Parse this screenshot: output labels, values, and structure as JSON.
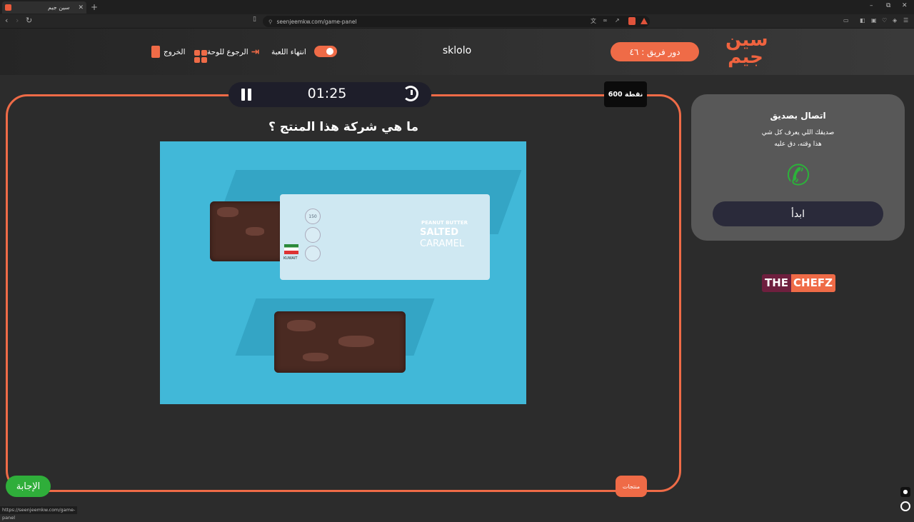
{
  "browser": {
    "tab_title": "سين جيم",
    "tab_close": "✕",
    "new_tab": "+",
    "url": "seenjeemkw.com/game-panel",
    "status_url": "https://seenjeemkw.com/game-panel",
    "window_controls": [
      "–",
      "⧉",
      "✕"
    ]
  },
  "header": {
    "logo_text_top": "سين",
    "logo_text_bottom": "جيم",
    "turn_label": "دور فريق : ٤٦",
    "team_name": "sklolo",
    "end_game_label": "انتهاء اللعبة",
    "back_to_board_label": "الرجوع للوحة",
    "exit_label": "الخروج",
    "accent_color": "#ef6b47"
  },
  "game": {
    "timer": "01:25",
    "points": "600 نقطة",
    "question": "ما هي شركة هذا المنتج ؟",
    "answer_button": "الإجابة",
    "category": "منتجات",
    "product_label": {
      "line1": "PEANUT BUTTER",
      "line2": "SALTED",
      "line3": "CARAMEL",
      "calories": "150",
      "origin": "KUWAIT"
    }
  },
  "lifeline": {
    "title": "اتصال بصديق",
    "description_line1": "صديقك اللي يعرف كل شي",
    "description_line2": "هذا وقته، دق عليه",
    "start_button": "ابدأ",
    "icon": "phone-icon"
  },
  "sponsor": {
    "part1": "THE",
    "part2": "CHEFZ"
  }
}
